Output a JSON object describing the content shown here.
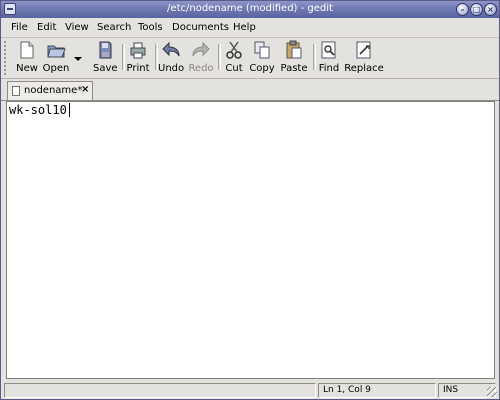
{
  "window": {
    "title": "/etc/nodename (modified) - gedit"
  },
  "menubar": {
    "items": [
      {
        "label": "File"
      },
      {
        "label": "Edit"
      },
      {
        "label": "View"
      },
      {
        "label": "Search"
      },
      {
        "label": "Tools"
      },
      {
        "label": "Documents"
      },
      {
        "label": "Help"
      }
    ]
  },
  "toolbar": {
    "buttons": [
      {
        "label": "New",
        "icon": "new-document-icon"
      },
      {
        "label": "Open",
        "icon": "open-folder-icon"
      },
      {
        "label": "Save",
        "icon": "save-icon"
      },
      {
        "label": "Print",
        "icon": "print-icon"
      },
      {
        "label": "Undo",
        "icon": "undo-icon"
      },
      {
        "label": "Redo",
        "icon": "redo-icon",
        "disabled": true
      },
      {
        "label": "Cut",
        "icon": "scissors-icon"
      },
      {
        "label": "Copy",
        "icon": "copy-icon"
      },
      {
        "label": "Paste",
        "icon": "paste-icon"
      },
      {
        "label": "Find",
        "icon": "find-icon"
      },
      {
        "label": "Replace",
        "icon": "replace-icon"
      }
    ]
  },
  "tabs": [
    {
      "label": "nodename*",
      "close": "×"
    }
  ],
  "editor": {
    "content": "wk-sol10"
  },
  "statusbar": {
    "position": "Ln 1, Col 9",
    "mode": "INS"
  },
  "colors": {
    "titlebar": "#6a74ae",
    "chrome": "#e4e2de",
    "editor_bg": "#ffffff"
  }
}
